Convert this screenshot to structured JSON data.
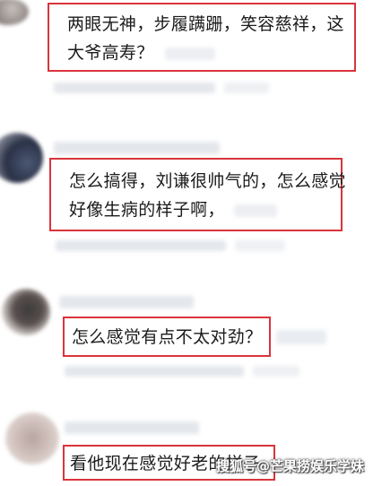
{
  "comments": [
    {
      "text_line1": "两眼无神，步履蹒跚，笑容慈祥，这",
      "text_line2": "大爷高寿？"
    },
    {
      "text_line1": "怎么搞得，刘谦很帅气的，怎么感觉",
      "text_line2": "好像生病的样子啊，"
    },
    {
      "text_line1": "怎么感觉有点不太对劲？"
    },
    {
      "text_line1": "看他现在感觉好老的样子"
    }
  ],
  "watermark": "搜狐号@芒果捞娱乐学妹",
  "colors": {
    "highlight_border": "#d9343c",
    "blur_gray": "#e4e7ec",
    "text": "#1b1b1b"
  }
}
